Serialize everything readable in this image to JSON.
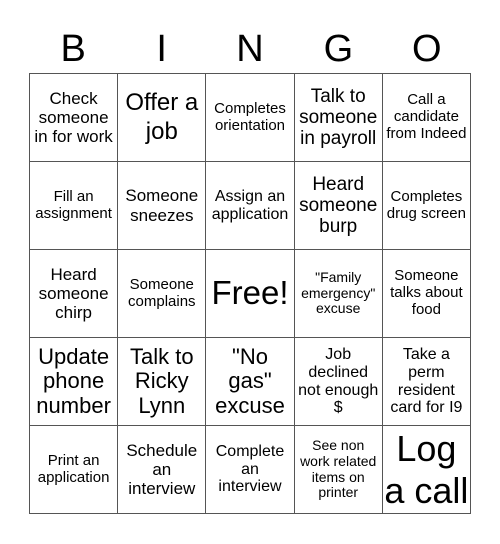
{
  "title_letters": [
    "B",
    "I",
    "N",
    "G",
    "O"
  ],
  "cells": [
    [
      "Check someone in for work",
      "Offer a job",
      "Completes orientation",
      "Talk to someone in payroll",
      "Call a candidate from Indeed"
    ],
    [
      "Fill an assignment",
      "Someone sneezes",
      "Assign an application",
      "Heard someone burp",
      "Completes drug screen"
    ],
    [
      "Heard someone chirp",
      "Someone complains",
      "Free!",
      "\"Family emergency\" excuse",
      "Someone talks about food"
    ],
    [
      "Update phone number",
      "Talk to Ricky Lynn",
      "\"No gas\" excuse",
      "Job declined not enough $",
      "Take a perm resident card for I9"
    ],
    [
      "Print an application",
      "Schedule an interview",
      "Complete an interview",
      "See non work related items on printer",
      "Log a call"
    ]
  ]
}
